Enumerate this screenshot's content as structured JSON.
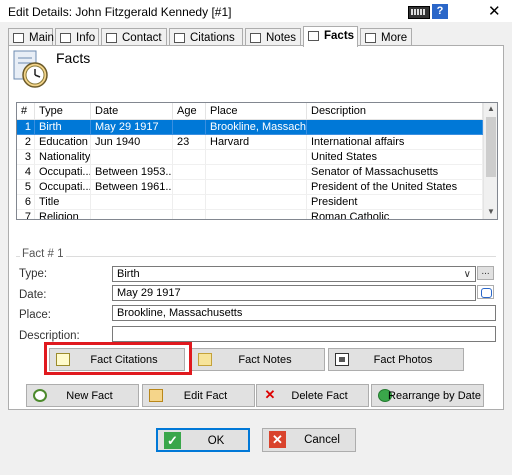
{
  "window": {
    "title": "Edit Details: John Fitzgerald Kennedy [#1]",
    "help_label": "?",
    "close_label": "✕"
  },
  "tabs": [
    {
      "label": "Main",
      "icon": "person-card-icon"
    },
    {
      "label": "Info",
      "icon": "info-list-icon"
    },
    {
      "label": "Contact",
      "icon": "house-icon"
    },
    {
      "label": "Citations",
      "icon": "citation-icon"
    },
    {
      "label": "Notes",
      "icon": "notes-icon"
    },
    {
      "label": "Facts",
      "icon": "facts-icon",
      "active": true
    },
    {
      "label": "More",
      "icon": "more-icon"
    }
  ],
  "section": {
    "heading": "Facts",
    "icon": "clock-document-icon"
  },
  "grid": {
    "columns": [
      "#",
      "Type",
      "Date",
      "Age",
      "Place",
      "Description"
    ],
    "rows": [
      {
        "num": "1",
        "type": "Birth",
        "date": "May 29 1917",
        "age": "",
        "place": "Brookline, Massach...",
        "description": "",
        "selected": true
      },
      {
        "num": "2",
        "type": "Education",
        "date": "Jun 1940",
        "age": "23",
        "place": "Harvard",
        "description": "International affairs"
      },
      {
        "num": "3",
        "type": "Nationality",
        "date": "",
        "age": "",
        "place": "",
        "description": "United States"
      },
      {
        "num": "4",
        "type": "Occupati...",
        "date": "Between 1953...",
        "age": "",
        "place": "",
        "description": "Senator of Massachusetts"
      },
      {
        "num": "5",
        "type": "Occupati...",
        "date": "Between 1961...",
        "age": "",
        "place": "",
        "description": "President of the United States"
      },
      {
        "num": "6",
        "type": "Title",
        "date": "",
        "age": "",
        "place": "",
        "description": "President"
      },
      {
        "num": "7",
        "type": "Religion",
        "date": "",
        "age": "",
        "place": "",
        "description": "Roman Catholic"
      }
    ]
  },
  "fact": {
    "legend": "Fact # 1",
    "type_label": "Type:",
    "type_value": "Birth",
    "date_label": "Date:",
    "date_value": "May 29 1917",
    "place_label": "Place:",
    "place_value": "Brookline, Massachusetts",
    "description_label": "Description:",
    "description_value": "",
    "dots_label": "..."
  },
  "buttons": {
    "fact_citations": "Fact Citations",
    "fact_notes": "Fact Notes",
    "fact_photos": "Fact Photos",
    "new_fact": "New Fact",
    "edit_fact": "Edit Fact",
    "delete_fact": "Delete Fact",
    "rearrange": "Rearrange by Date",
    "ok": "OK",
    "cancel": "Cancel"
  },
  "highlight": {
    "target": "Fact Citations",
    "color": "#e0191e"
  },
  "colors": {
    "selection": "#0078d7",
    "ok_icon": "#3aa64a",
    "cancel_icon": "#d9432c"
  }
}
